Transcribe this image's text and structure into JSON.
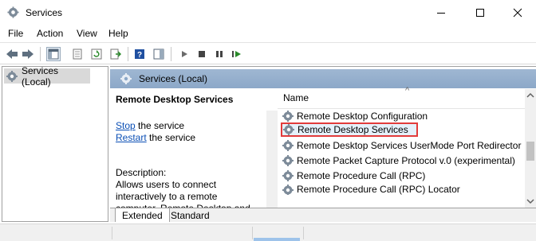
{
  "window": {
    "title": "Services",
    "app_icon": "services-gear-icon",
    "controls": [
      "minimize-icon",
      "maximize-icon",
      "close-icon"
    ]
  },
  "menu": [
    "File",
    "Action",
    "View",
    "Help"
  ],
  "toolbar": {
    "icons": [
      "back-arrow-icon",
      "forward-arrow-icon",
      "console-tree-icon",
      "properties-icon",
      "refresh-icon",
      "export-list-icon",
      "help-icon",
      "show-hide-icon",
      "start-service-icon",
      "stop-service-icon",
      "pause-service-icon",
      "restart-service-icon"
    ]
  },
  "tree": {
    "selected_node": "Services (Local)"
  },
  "right_header": {
    "label": "Services (Local)"
  },
  "description_panel": {
    "service_name": "Remote Desktop Services",
    "stop_link": "Stop",
    "stop_suffix": " the service",
    "restart_link": "Restart",
    "restart_suffix": " the service",
    "description_label": "Description:",
    "description_lines": [
      "Allows users to connect",
      "interactively to a remote",
      "computer. Remote Desktop and"
    ]
  },
  "list": {
    "column_name": "Name",
    "rows": [
      {
        "name": "Remote Desktop Configuration",
        "selected": false
      },
      {
        "name": "Remote Desktop Services",
        "selected": true
      },
      {
        "name": "Remote Desktop Services UserMode Port Redirector",
        "selected": false
      },
      {
        "name": "Remote Packet Capture Protocol v.0 (experimental)",
        "selected": false
      },
      {
        "name": "Remote Procedure Call (RPC)",
        "selected": false
      },
      {
        "name": "Remote Procedure Call (RPC) Locator",
        "selected": false
      }
    ]
  },
  "tabs": {
    "extended": "Extended",
    "standard": "Standard"
  },
  "colors": {
    "header_blue": "#8ca8c8",
    "link_blue": "#0b4fb5",
    "highlight_red": "#e23b3b",
    "tree_selected": "#d9d9d9"
  }
}
